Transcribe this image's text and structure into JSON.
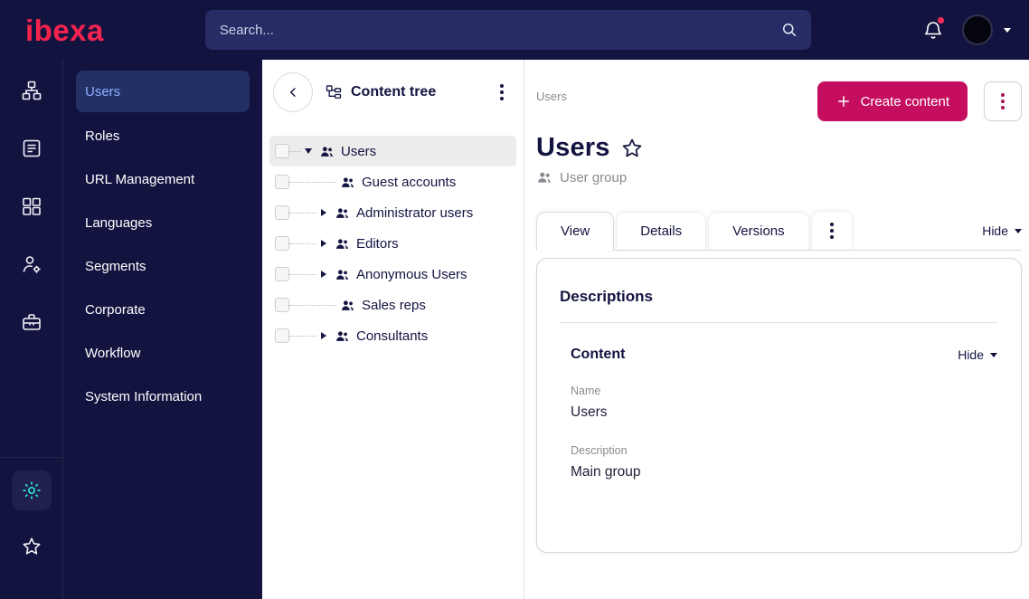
{
  "colors": {
    "accent": "#c50e5f",
    "accent_red": "#f5244f",
    "dark_navy": "#131340",
    "panel_navy": "#272c66",
    "active_item_bg": "#233066",
    "active_item_text": "#8fb0ff",
    "teal": "#2fe0cb",
    "text_dark": "#131441",
    "text_gray": "#878b90",
    "border_gray": "#d6d6d6",
    "selected_row_bg": "#ececec"
  },
  "topbar": {
    "logo_text": "ibexa",
    "search": {
      "placeholder": "Search..."
    },
    "notification_dot": true
  },
  "icon_rail": {
    "items": [
      {
        "icon": "sitemap-icon"
      },
      {
        "icon": "content-list-icon"
      },
      {
        "icon": "blocks-icon"
      },
      {
        "icon": "user-admin-icon"
      },
      {
        "icon": "toolbox-icon"
      }
    ],
    "bottom_items": [
      {
        "icon": "settings-gear-icon",
        "active": true
      },
      {
        "icon": "star-icon",
        "active": false
      }
    ]
  },
  "sidebar": {
    "items": [
      {
        "label": "Users",
        "active": true
      },
      {
        "label": "Roles",
        "active": false
      },
      {
        "label": "URL Management",
        "active": false
      },
      {
        "label": "Languages",
        "active": false
      },
      {
        "label": "Segments",
        "active": false
      },
      {
        "label": "Corporate",
        "active": false
      },
      {
        "label": "Workflow",
        "active": false
      },
      {
        "label": "System Information",
        "active": false
      }
    ]
  },
  "content_tree": {
    "title": "Content tree",
    "items": [
      {
        "label": "Users",
        "depth": 0,
        "expanded": true,
        "selected": true,
        "has_children": true,
        "checked": false,
        "icon": "user-group-icon"
      },
      {
        "label": "Guest accounts",
        "depth": 1,
        "has_children": false,
        "checked": false,
        "icon": "user-group-icon"
      },
      {
        "label": "Administrator users",
        "depth": 1,
        "has_children": true,
        "checked": false,
        "icon": "user-group-icon"
      },
      {
        "label": "Editors",
        "depth": 1,
        "has_children": true,
        "checked": false,
        "icon": "user-group-icon"
      },
      {
        "label": "Anonymous Users",
        "depth": 1,
        "has_children": true,
        "checked": false,
        "icon": "user-group-icon"
      },
      {
        "label": "Sales reps",
        "depth": 1,
        "has_children": false,
        "checked": false,
        "icon": "user-group-icon"
      },
      {
        "label": "Consultants",
        "depth": 1,
        "has_children": true,
        "checked": false,
        "icon": "user-group-icon"
      }
    ]
  },
  "main": {
    "breadcrumb": "Users",
    "create_button_label": "Create content",
    "title": "Users",
    "content_type_label": "User group",
    "tabs": [
      {
        "label": "View",
        "active": true
      },
      {
        "label": "Details",
        "active": false
      },
      {
        "label": "Versions",
        "active": false
      }
    ],
    "hide_toggle_label": "Hide",
    "card": {
      "heading": "Descriptions",
      "section": {
        "heading": "Content",
        "hide_toggle_label": "Hide",
        "fields": [
          {
            "label": "Name",
            "value": "Users"
          },
          {
            "label": "Description",
            "value": "Main group"
          }
        ]
      }
    }
  }
}
